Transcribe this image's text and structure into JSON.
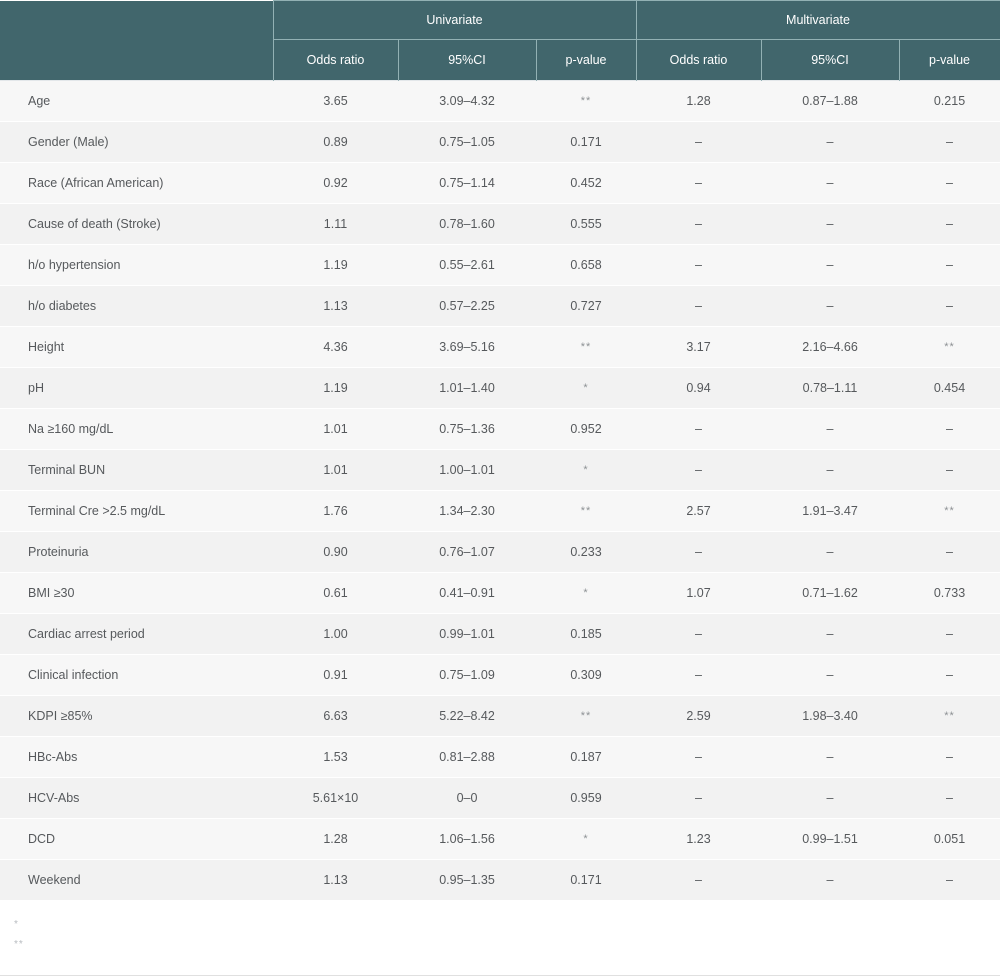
{
  "table": {
    "corner_label": "",
    "group_headers": [
      {
        "label": "Univariate",
        "span": 3
      },
      {
        "label": "Multivariate",
        "span": 3
      }
    ],
    "column_headers": [
      "Odds ratio",
      "95%CI",
      "p-value",
      "Odds ratio",
      "95%CI",
      "p-value"
    ],
    "rows": [
      {
        "label": "Age",
        "u_or": "3.65",
        "u_ci": "3.09–4.32",
        "u_p": "**",
        "m_or": "1.28",
        "m_ci": "0.87–1.88",
        "m_p": "0.215"
      },
      {
        "label": "Gender (Male)",
        "u_or": "0.89",
        "u_ci": "0.75–1.05",
        "u_p": "0.171",
        "m_or": "–",
        "m_ci": "–",
        "m_p": "–"
      },
      {
        "label": "Race (African American)",
        "u_or": "0.92",
        "u_ci": "0.75–1.14",
        "u_p": "0.452",
        "m_or": "–",
        "m_ci": "–",
        "m_p": "–"
      },
      {
        "label": "Cause of death (Stroke)",
        "u_or": "1.11",
        "u_ci": "0.78–1.60",
        "u_p": "0.555",
        "m_or": "–",
        "m_ci": "–",
        "m_p": "–"
      },
      {
        "label": "h/o hypertension",
        "u_or": "1.19",
        "u_ci": "0.55–2.61",
        "u_p": "0.658",
        "m_or": "–",
        "m_ci": "–",
        "m_p": "–"
      },
      {
        "label": "h/o diabetes",
        "u_or": "1.13",
        "u_ci": "0.57–2.25",
        "u_p": "0.727",
        "m_or": "–",
        "m_ci": "–",
        "m_p": "–"
      },
      {
        "label": "Height",
        "u_or": "4.36",
        "u_ci": "3.69–5.16",
        "u_p": "**",
        "m_or": "3.17",
        "m_ci": "2.16–4.66",
        "m_p": "**"
      },
      {
        "label": "pH",
        "u_or": "1.19",
        "u_ci": "1.01–1.40",
        "u_p": "*",
        "m_or": "0.94",
        "m_ci": "0.78–1.11",
        "m_p": "0.454"
      },
      {
        "label": "Na ≥160 mg/dL",
        "u_or": "1.01",
        "u_ci": "0.75–1.36",
        "u_p": "0.952",
        "m_or": "–",
        "m_ci": "–",
        "m_p": "–"
      },
      {
        "label": "Terminal BUN",
        "u_or": "1.01",
        "u_ci": "1.00–1.01",
        "u_p": "*",
        "m_or": "–",
        "m_ci": "–",
        "m_p": "–"
      },
      {
        "label": "Terminal Cre >2.5 mg/dL",
        "u_or": "1.76",
        "u_ci": "1.34–2.30",
        "u_p": "**",
        "m_or": "2.57",
        "m_ci": "1.91–3.47",
        "m_p": "**"
      },
      {
        "label": "Proteinuria",
        "u_or": "0.90",
        "u_ci": "0.76–1.07",
        "u_p": "0.233",
        "m_or": "–",
        "m_ci": "–",
        "m_p": "–"
      },
      {
        "label": "BMI ≥30",
        "u_or": "0.61",
        "u_ci": "0.41–0.91",
        "u_p": "*",
        "m_or": "1.07",
        "m_ci": "0.71–1.62",
        "m_p": "0.733"
      },
      {
        "label": "Cardiac arrest period",
        "u_or": "1.00",
        "u_ci": "0.99–1.01",
        "u_p": "0.185",
        "m_or": "–",
        "m_ci": "–",
        "m_p": "–"
      },
      {
        "label": "Clinical infection",
        "u_or": "0.91",
        "u_ci": "0.75–1.09",
        "u_p": "0.309",
        "m_or": "–",
        "m_ci": "–",
        "m_p": "–"
      },
      {
        "label": "KDPI ≥85%",
        "u_or": "6.63",
        "u_ci": "5.22–8.42",
        "u_p": "**",
        "m_or": "2.59",
        "m_ci": "1.98–3.40",
        "m_p": "**"
      },
      {
        "label": "HBc-Abs",
        "u_or": "1.53",
        "u_ci": "0.81–2.88",
        "u_p": "0.187",
        "m_or": "–",
        "m_ci": "–",
        "m_p": "–"
      },
      {
        "label": "HCV-Abs",
        "u_or": "5.61×10",
        "u_ci": "0–0",
        "u_p": "0.959",
        "m_or": "–",
        "m_ci": "–",
        "m_p": "–"
      },
      {
        "label": "DCD",
        "u_or": "1.28",
        "u_ci": "1.06–1.56",
        "u_p": "*",
        "m_or": "1.23",
        "m_ci": "0.99–1.51",
        "m_p": "0.051"
      },
      {
        "label": "Weekend",
        "u_or": "1.13",
        "u_ci": "0.95–1.35",
        "u_p": "0.171",
        "m_or": "–",
        "m_ci": "–",
        "m_p": "–"
      }
    ]
  },
  "footnotes": [
    "*",
    "**"
  ],
  "colors": {
    "header_bg": "#41666c",
    "header_text": "#ffffff",
    "header_border": "#92b1b4",
    "row_odd_bg": "#f7f7f7",
    "row_even_bg": "#f2f2f2",
    "body_text": "#56595c",
    "footnote_text": "#b8bcc0"
  }
}
